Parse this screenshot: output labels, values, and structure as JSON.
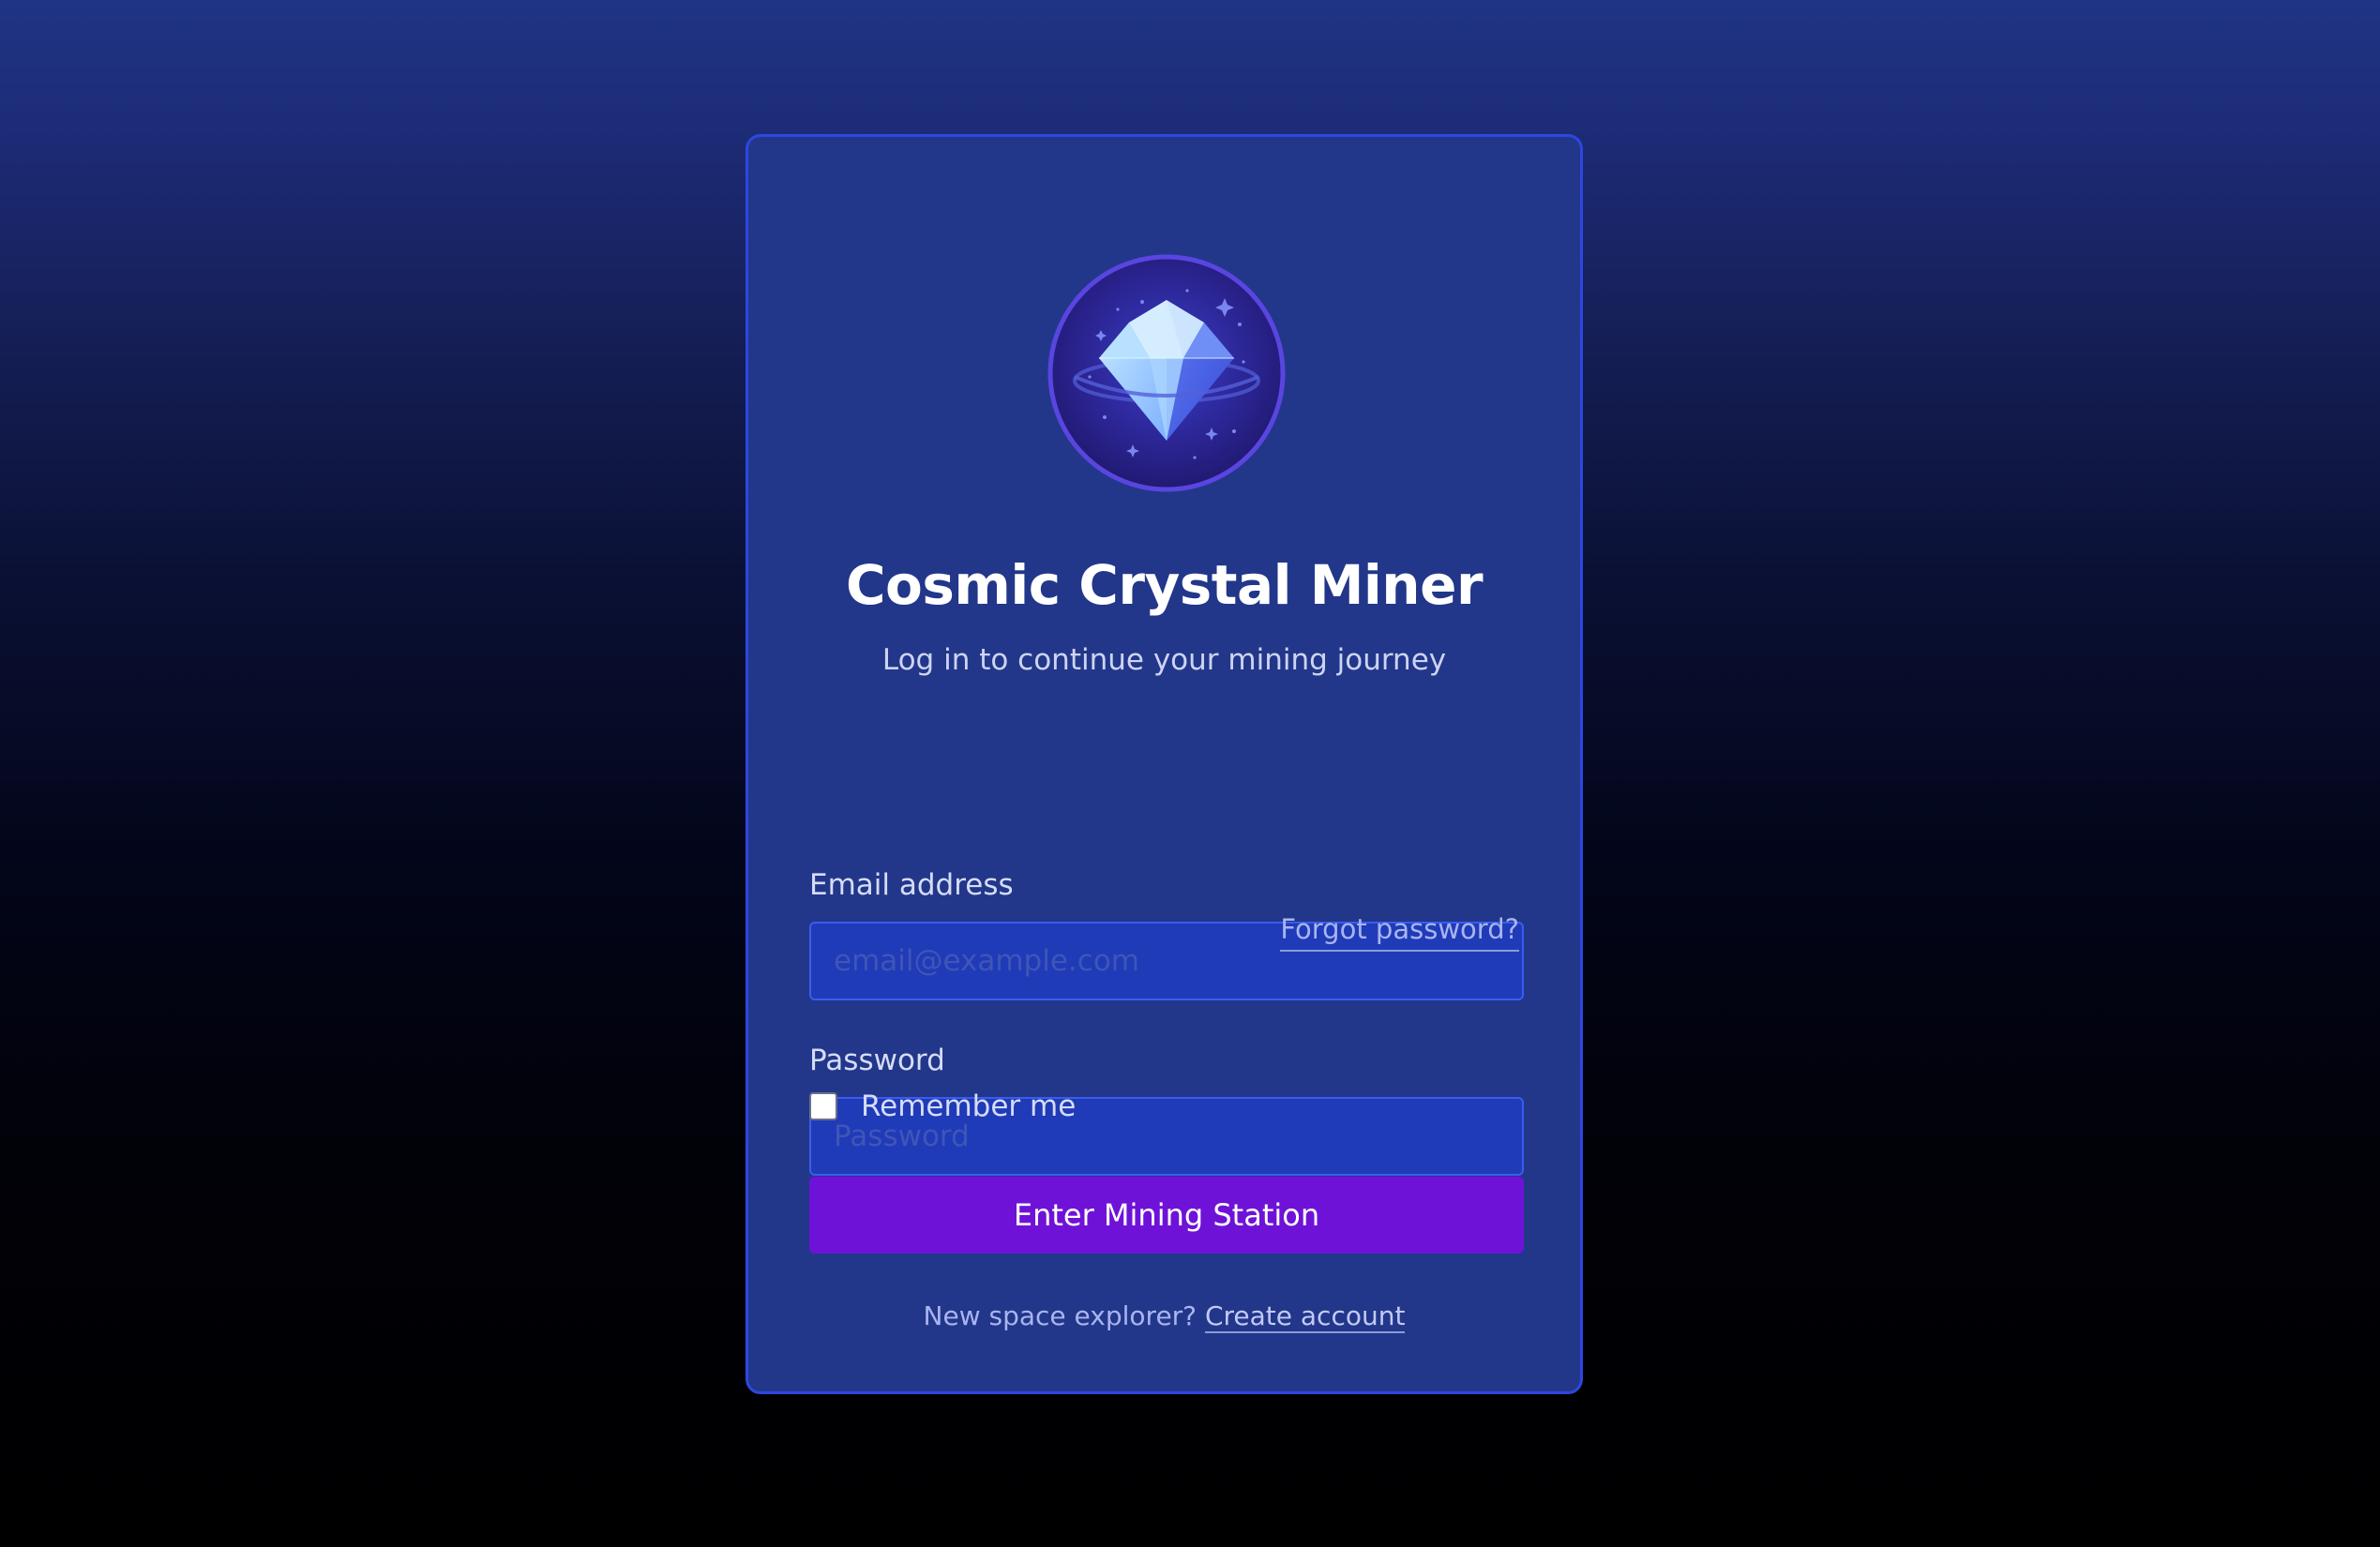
{
  "app": {
    "title": "Cosmic Crystal Miner",
    "subtitle": "Log in to continue your mining journey",
    "logo_icon": "crystal-planet-icon"
  },
  "form": {
    "email_label": "Email address",
    "email_placeholder": "email@example.com",
    "email_value": "",
    "password_label": "Password",
    "password_placeholder": "Password",
    "password_value": "",
    "forgot_label": "Forgot password?",
    "remember_label": "Remember me",
    "remember_checked": false,
    "submit_label": "Enter Mining Station"
  },
  "signup": {
    "prompt": "New space explorer?",
    "link_label": "Create account"
  },
  "colors": {
    "card_bg": "#22378a",
    "card_border": "#2d47e0",
    "input_bg": "#1f3bb7",
    "button_bg": "#6f12d8",
    "crystal": "#7fb2ff"
  }
}
